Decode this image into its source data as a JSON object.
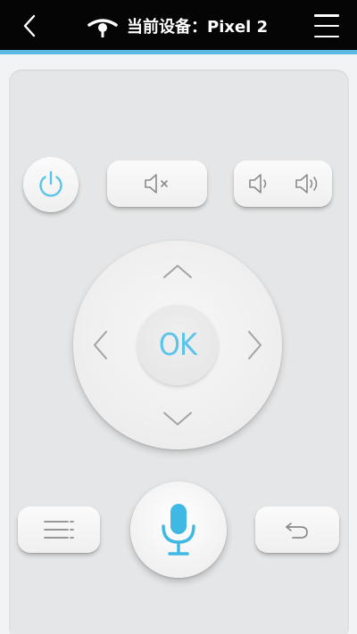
{
  "header": {
    "back_icon": "chevron-left-icon",
    "device_icon": "device-logo-icon",
    "title": "当前设备：Pixel 2",
    "menu_icon": "hamburger-menu-icon"
  },
  "remote": {
    "power_icon": "power-icon",
    "mute_icon": "volume-mute-icon",
    "volume_down_icon": "volume-down-icon",
    "volume_up_icon": "volume-up-icon",
    "dpad": {
      "up_icon": "chevron-up-icon",
      "down_icon": "chevron-down-icon",
      "left_icon": "chevron-left-icon",
      "right_icon": "chevron-right-icon",
      "ok_label": "OK"
    },
    "menu_icon": "list-menu-icon",
    "voice_icon": "microphone-icon",
    "return_icon": "return-icon"
  },
  "colors": {
    "topbar": "#050505",
    "accent": "#5bb8e2",
    "panel": "#e5e6e7",
    "icon_gray": "#8a8a8a",
    "ok_blue": "#5cc3ea"
  }
}
